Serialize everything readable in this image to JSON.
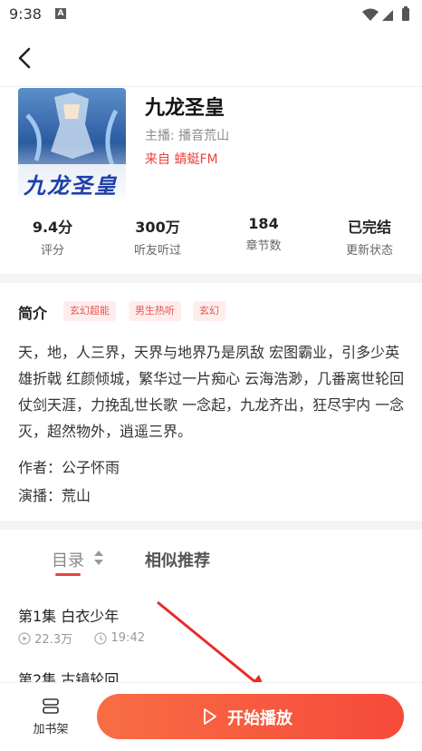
{
  "status_bar": {
    "time": "9:38",
    "notif_letter": "A"
  },
  "book": {
    "title": "九龙圣皇",
    "host": "主播: 播音荒山",
    "source": "来自 蜻蜓FM",
    "cover_text": "九龙圣皇"
  },
  "stats": [
    {
      "value": "9.4分",
      "label": "评分"
    },
    {
      "value": "300万",
      "label": "听友听过"
    },
    {
      "value": "184",
      "label": "章节数"
    },
    {
      "value": "已完结",
      "label": "更新状态"
    }
  ],
  "intro": {
    "label": "简介",
    "tags": [
      "玄幻超能",
      "男生热听",
      "玄幻"
    ],
    "text": "天，地，人三界，天界与地界乃是夙敌 宏图霸业，引多少英雄折戟 红颜倾城，繁华过一片痴心 云海浩渺，几番离世轮回 仗剑天涯，力挽乱世长歌 一念起，九龙齐出，狂尽宇内 一念灭，超然物外，逍遥三界。",
    "author": "作者：公子怀雨",
    "narrator": "演播：荒山"
  },
  "tabs": {
    "catalog": "目录",
    "similar": "相似推荐"
  },
  "episodes": [
    {
      "title": "第1集 白衣少年",
      "plays": "22.3万",
      "duration": "19:42"
    },
    {
      "title": "第2集 古镜轮回"
    }
  ],
  "bottom": {
    "shelf_label": "加书架",
    "play_label": "开始播放"
  },
  "colors": {
    "accent": "#e8423f",
    "play_start": "#f86d44",
    "play_end": "#f64a3a"
  }
}
